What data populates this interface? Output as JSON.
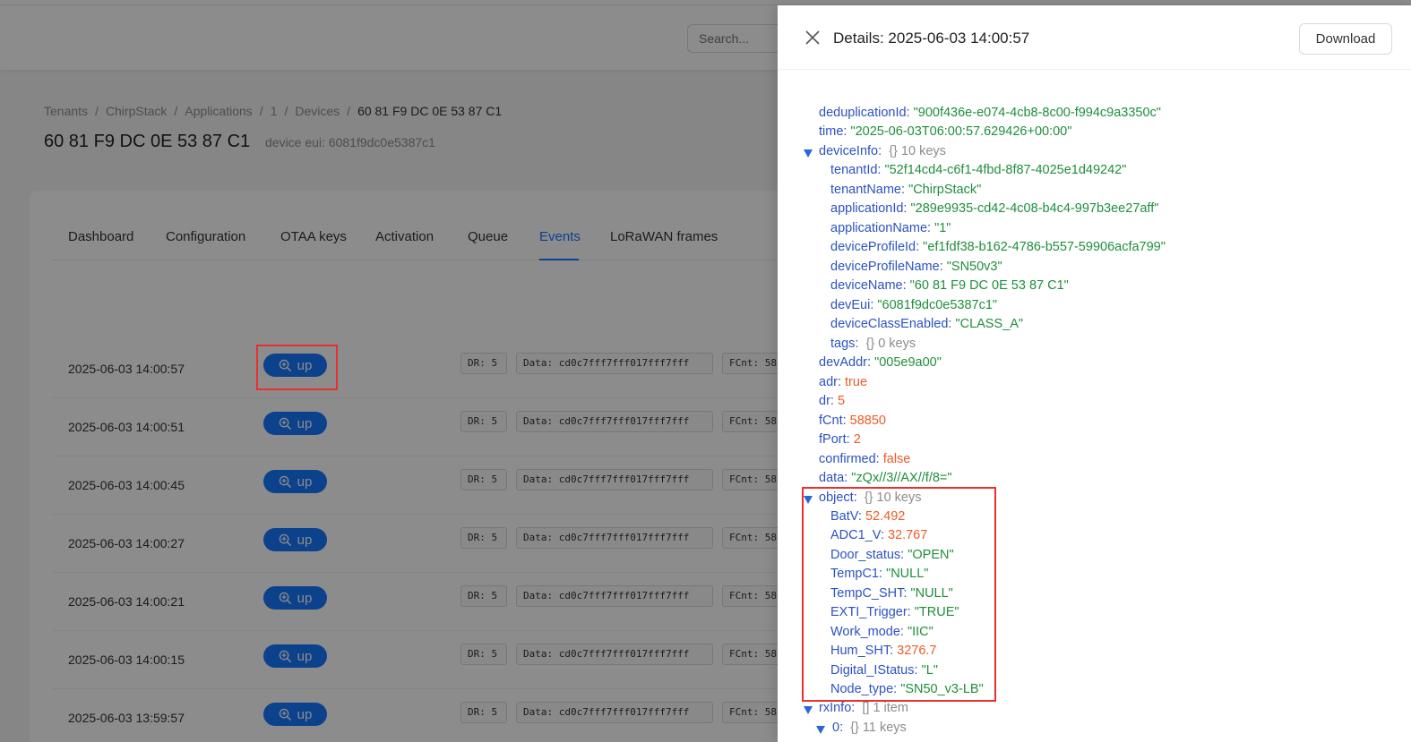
{
  "header": {
    "search_placeholder": "Search..."
  },
  "breadcrumb": [
    "Tenants",
    "ChirpStack",
    "Applications",
    "1",
    "Devices",
    "60 81 F9 DC 0E 53 87 C1"
  ],
  "breadcrumb_sep": "/",
  "page": {
    "title": "60 81 F9 DC 0E 53 87 C1",
    "subtitle": "device eui: 6081f9dc0e5387c1"
  },
  "tabs": [
    "Dashboard",
    "Configuration",
    "OTAA keys",
    "Activation",
    "Queue",
    "Events",
    "LoRaWAN frames"
  ],
  "active_tab": "Events",
  "events": [
    {
      "time": "2025-06-03 14:00:57",
      "type": "up",
      "dr": "DR: 5",
      "data": "Data: cd0c7fff7fff017fff7fff",
      "fcnt": "FCnt: 58"
    },
    {
      "time": "2025-06-03 14:00:51",
      "type": "up",
      "dr": "DR: 5",
      "data": "Data: cd0c7fff7fff017fff7fff",
      "fcnt": "FCnt: 58"
    },
    {
      "time": "2025-06-03 14:00:45",
      "type": "up",
      "dr": "DR: 5",
      "data": "Data: cd0c7fff7fff017fff7fff",
      "fcnt": "FCnt: 58"
    },
    {
      "time": "2025-06-03 14:00:27",
      "type": "up",
      "dr": "DR: 5",
      "data": "Data: cd0c7fff7fff017fff7fff",
      "fcnt": "FCnt: 58"
    },
    {
      "time": "2025-06-03 14:00:21",
      "type": "up",
      "dr": "DR: 5",
      "data": "Data: cd0c7fff7fff017fff7fff",
      "fcnt": "FCnt: 58"
    },
    {
      "time": "2025-06-03 14:00:15",
      "type": "up",
      "dr": "DR: 5",
      "data": "Data: cd0c7fff7fff017fff7fff",
      "fcnt": "FCnt: 58"
    },
    {
      "time": "2025-06-03 13:59:57",
      "type": "up",
      "dr": "DR: 5",
      "data": "Data: cd0c7fff7fff017fff7fff",
      "fcnt": "FCnt: 58"
    }
  ],
  "drawer": {
    "title": "Details: 2025-06-03 14:00:57",
    "download_label": "Download",
    "json": {
      "deduplicationId": {
        "key": "deduplicationId:",
        "value": "\"900f436e-e074-4cb8-8c00-f994c9a3350c\""
      },
      "time": {
        "key": "time:",
        "value": "\"2025-06-03T06:00:57.629426+00:00\""
      },
      "deviceInfo": {
        "key": "deviceInfo:",
        "meta": "{}  10 keys",
        "tenantId": {
          "key": "tenantId:",
          "value": "\"52f14cd4-c6f1-4fbd-8f87-4025e1d49242\""
        },
        "tenantName": {
          "key": "tenantName:",
          "value": "\"ChirpStack\""
        },
        "applicationId": {
          "key": "applicationId:",
          "value": "\"289e9935-cd42-4c08-b4c4-997b3ee27aff\""
        },
        "applicationName": {
          "key": "applicationName:",
          "value": "\"1\""
        },
        "deviceProfileId": {
          "key": "deviceProfileId:",
          "value": "\"ef1fdf38-b162-4786-b557-59906acfa799\""
        },
        "deviceProfileName": {
          "key": "deviceProfileName:",
          "value": "\"SN50v3\""
        },
        "deviceName": {
          "key": "deviceName:",
          "value": "\"60 81 F9 DC 0E 53 87 C1\""
        },
        "devEui": {
          "key": "devEui:",
          "value": "\"6081f9dc0e5387c1\""
        },
        "deviceClassEnabled": {
          "key": "deviceClassEnabled:",
          "value": "\"CLASS_A\""
        },
        "tags": {
          "key": "tags:",
          "meta": "{}  0 keys"
        }
      },
      "devAddr": {
        "key": "devAddr:",
        "value": "\"005e9a00\""
      },
      "adr": {
        "key": "adr:",
        "value": "true"
      },
      "dr": {
        "key": "dr:",
        "value": "5"
      },
      "fCnt": {
        "key": "fCnt:",
        "value": "58850"
      },
      "fPort": {
        "key": "fPort:",
        "value": "2"
      },
      "confirmed": {
        "key": "confirmed:",
        "value": "false"
      },
      "data": {
        "key": "data:",
        "value": "\"zQx//3//AX//f/8=\""
      },
      "object": {
        "key": "object:",
        "meta": "{}  10 keys",
        "BatV": {
          "key": "BatV:",
          "value": "52.492"
        },
        "ADC1_V": {
          "key": "ADC1_V:",
          "value": "32.767"
        },
        "Door_status": {
          "key": "Door_status:",
          "value": "\"OPEN\""
        },
        "TempC1": {
          "key": "TempC1:",
          "value": "\"NULL\""
        },
        "TempC_SHT": {
          "key": "TempC_SHT:",
          "value": "\"NULL\""
        },
        "EXTI_Trigger": {
          "key": "EXTI_Trigger:",
          "value": "\"TRUE\""
        },
        "Work_mode": {
          "key": "Work_mode:",
          "value": "\"IIC\""
        },
        "Hum_SHT": {
          "key": "Hum_SHT:",
          "value": "3276.7"
        },
        "Digital_IStatus": {
          "key": "Digital_IStatus:",
          "value": "\"L\""
        },
        "Node_type": {
          "key": "Node_type:",
          "value": "\"SN50_v3-LB\""
        }
      },
      "rxInfo": {
        "key": "rxInfo:",
        "meta": "[]  1 item"
      },
      "rxInfo0": {
        "key": "0:",
        "meta": "{}  11 keys"
      }
    }
  },
  "colors": {
    "accent": "#1677ff",
    "highlight": "#e8312f",
    "json_key": "#2b52c4",
    "json_string": "#1f8f3a",
    "json_number": "#f05a24"
  },
  "icons": {
    "close": "close-icon",
    "up_button": "zoom-in-icon",
    "expand": "caret-down-icon"
  }
}
